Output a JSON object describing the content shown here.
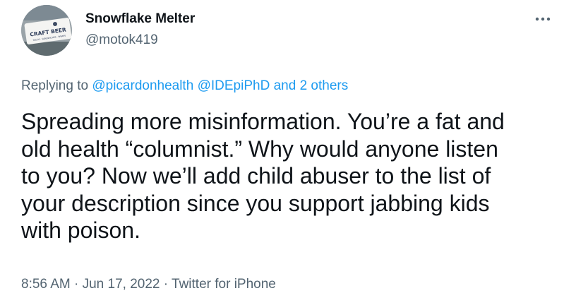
{
  "author": {
    "display_name": "Snowflake Melter",
    "handle": "@motok419",
    "avatar_icon": "avatar-craft-beer-sign",
    "avatar_text_line1": "CRAFT BEER",
    "avatar_text_line2": "TACOS · SANDWICHES · WRAPS"
  },
  "more_menu": {
    "icon": "more-horizontal-icon"
  },
  "reply_context": {
    "prefix": "Replying to",
    "mention_1": "@picardonhealth",
    "mention_2": "@IDEpiPhD",
    "joiner": "and",
    "others": "2 others"
  },
  "tweet": {
    "lines": [
      "Spreading more misinformation. You’re a fat and",
      "old health “columnist.” Why would anyone listen",
      "to you? Now we’ll add child abuser to the list of",
      "your description since you support jabbing kids",
      "with poison."
    ]
  },
  "meta": {
    "time": "8:56 AM",
    "separator": "·",
    "date": "Jun 17, 2022",
    "source": "Twitter for iPhone"
  },
  "colors": {
    "text": "#0f1419",
    "secondary": "#536471",
    "link": "#1d9bf0",
    "background": "#ffffff"
  }
}
